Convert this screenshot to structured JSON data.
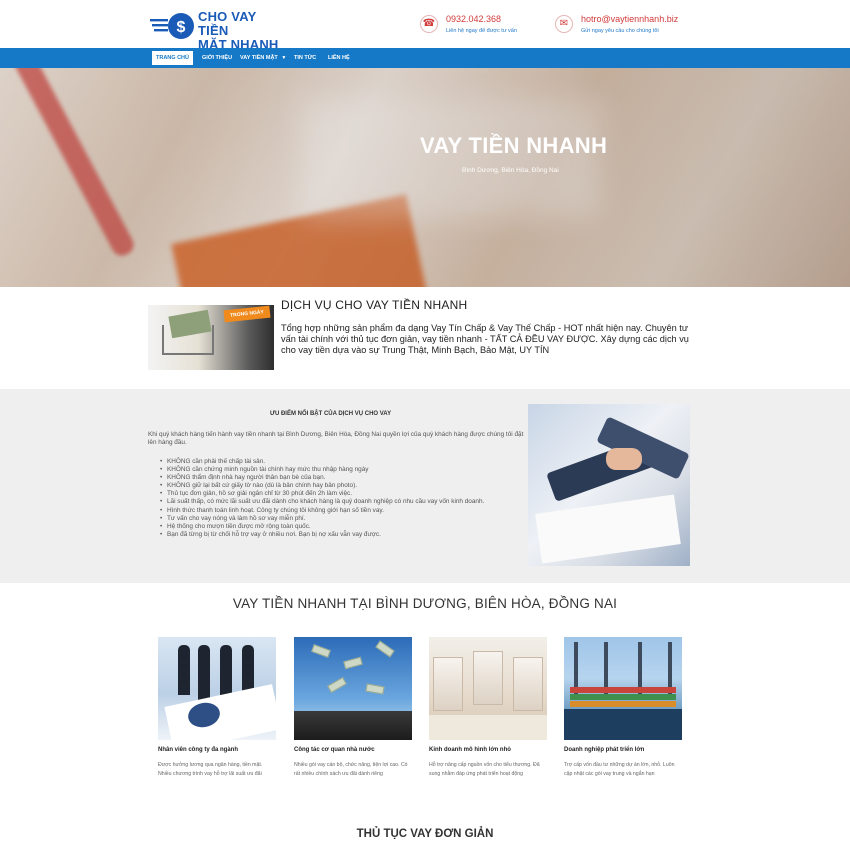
{
  "brand": {
    "logo_text": [
      "CHO VAY TIỀN",
      "MẶT NHANH"
    ],
    "logo_icon": "dollar-badge-icon",
    "color_primary": "#1679c7",
    "color_accent": "#d23b3b"
  },
  "header": {
    "phone": {
      "icon": "phone-icon",
      "value": "0932.042.368",
      "note": "Liên hệ ngay để được tư vấn"
    },
    "email": {
      "icon": "mail-icon",
      "value": "hotro@vaytiennhanh.biz",
      "note": "Gửi ngay yêu cầu cho chúng tôi"
    }
  },
  "nav": {
    "items": [
      {
        "label": "Trang chủ",
        "active": true
      },
      {
        "label": "Giới thiệu"
      },
      {
        "label": "Vay tiền mặt",
        "dropdown": true
      },
      {
        "label": "Tin tức"
      },
      {
        "label": "Liên hệ"
      }
    ]
  },
  "hero": {
    "title": "VAY TIỀN NHANH",
    "subtitle": "Bình Dương, Biên Hòa, Đồng Nai"
  },
  "service": {
    "image_banner": "TRONG NGÀY",
    "title": "DỊCH VỤ CHO VAY TIỀN NHANH",
    "description": "Tổng hợp những sản phẩm đa dạng Vay Tín Chấp & Vay Thế Chấp - HOT nhất hiện nay. Chuyên tư vấn tài chính với thủ tục đơn giản, vay tiền nhanh - TẤT CẢ ĐỀU VAY ĐƯỢC. Xây dựng các dịch vụ cho vay tiền dựa vào sự Trung Thật, Minh Bạch, Bảo Mật, UY TÍN"
  },
  "advantages": {
    "title": "ƯU ĐIỂM NỔI BẬT CỦA DỊCH VỤ CHO VAY",
    "intro": "Khi quý khách hàng tiến hành vay tiền nhanh tại Bình Dương, Biên Hòa, Đồng Nai quyền lợi của quý khách hàng được chúng tôi đặt lên hàng đầu.",
    "items": [
      "KHÔNG cần phải thế chấp tài sản.",
      "KHÔNG cần chứng minh nguồn tài chính hay mức thu nhập hàng ngày",
      "KHÔNG thẩm định nhà hay người thân bạn bè của bạn.",
      "KHÔNG giữ lại bất cứ giấy tờ nào (dù là bản chính hay bản photo).",
      "Thủ tục đơn giản, hồ sơ giải ngân chỉ từ 30 phút đến 2h làm việc.",
      "Lãi suất thấp, có mức lãi suất ưu đãi dành cho khách hàng là quý doanh nghiệp có nhu cầu vay vốn kinh doanh.",
      "Hình thức thanh toán linh hoạt. Công ty chúng tôi không giới hạn số tiền vay.",
      "Tư vấn cho vay nóng  và làm hồ sơ vay miễn phí.",
      "Hệ thống cho mượn tiền được mở rộng toàn quốc.",
      "Bạn đã từng bị từ chối hỗ trợ vay ở nhiều nơi. Bạn bị nợ xấu vẫn vay được."
    ]
  },
  "locations": {
    "title": "VAY TIỀN NHANH TẠI BÌNH DƯƠNG, BIÊN HÒA, ĐỒNG NAI",
    "cards": [
      {
        "name": "Nhân viên công ty đa ngành",
        "desc": "Được hưởng lương qua ngân hàng, tiền mặt. Nhiều chương trình vay hỗ trợ lãi suất ưu đãi"
      },
      {
        "name": "Công tác cơ quan nhà nước",
        "desc": "Nhiều gói vay cán bộ, chức năng, tiện lợi cao. Có rất nhiều chính sách ưu đãi dành riêng"
      },
      {
        "name": "Kinh doanh mô hình lớn nhỏ",
        "desc": "Hỗ trợ nâng cấp nguồn vốn cho tiểu thương. Đã sung nhằm đáp ứng phát triển hoạt động"
      },
      {
        "name": "Doanh nghiệp phát triển lớn",
        "desc": "Trợ cấp vốn đầu tư những dự án lớn, nhỏ. Luôn cập nhật các gói vay trung và ngắn hạn"
      }
    ]
  },
  "procedure": {
    "title": "THỦ TỤC VAY ĐƠN GIẢN"
  }
}
